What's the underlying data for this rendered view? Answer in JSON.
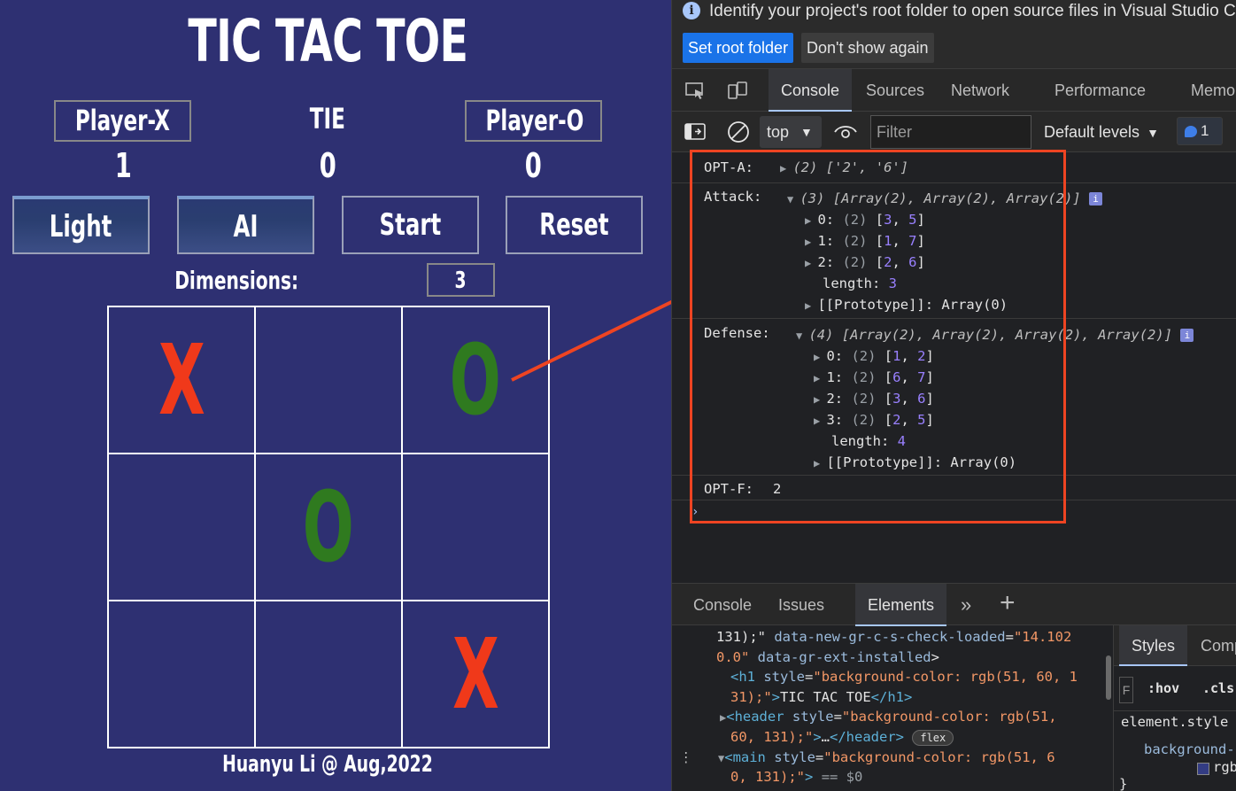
{
  "game": {
    "title": "TIC TAC TOE",
    "players": {
      "x_label": "Player-X",
      "tie_label": "TIE",
      "o_label": "Player-O"
    },
    "scores": {
      "x": "1",
      "tie": "0",
      "o": "0"
    },
    "buttons": {
      "light": "Light",
      "ai": "AI",
      "start": "Start",
      "reset": "Reset"
    },
    "dimensions_label": "Dimensions:",
    "dimensions_value": "3",
    "board": [
      "X",
      "",
      "O",
      "",
      "O",
      "",
      "",
      "",
      "X"
    ],
    "footer": "Huanyu Li @ Aug,2022",
    "colors": {
      "background": "#2e3072",
      "x_mark": "#f0391a",
      "o_mark": "#2f7a1f"
    }
  },
  "devtools": {
    "infobar": {
      "message": "Identify your project's root folder to open source files in Visual Studio Code",
      "set_root": "Set root folder",
      "dont_show": "Don't show again"
    },
    "tabs": [
      "Console",
      "Sources",
      "Network",
      "Performance",
      "Memo"
    ],
    "toolbar": {
      "context": "top",
      "filter_placeholder": "Filter",
      "levels": "Default levels",
      "message_count": "1"
    },
    "console": {
      "opt_a": {
        "label": "OPT-A:",
        "preview": "(2) ['2', '6']"
      },
      "attack": {
        "label": "Attack:",
        "preview": "(3) [Array(2), Array(2), Array(2)]",
        "items": [
          {
            "idx": "0",
            "values": [
              3,
              5
            ]
          },
          {
            "idx": "1",
            "values": [
              1,
              7
            ]
          },
          {
            "idx": "2",
            "values": [
              2,
              6
            ]
          }
        ],
        "length": "3"
      },
      "defense": {
        "label": "Defense:",
        "preview": "(4) [Array(2), Array(2), Array(2), Array(2)]",
        "items": [
          {
            "idx": "0",
            "values": [
              1,
              2
            ]
          },
          {
            "idx": "1",
            "values": [
              6,
              7
            ]
          },
          {
            "idx": "2",
            "values": [
              3,
              6
            ]
          },
          {
            "idx": "3",
            "values": [
              2,
              5
            ]
          }
        ],
        "length": "4"
      },
      "opt_f": {
        "label": "OPT-F:",
        "value": "2"
      },
      "prototype_text": "[[Prototype]]: Array(0)"
    },
    "drawer_tabs": [
      "Console",
      "Issues",
      "Elements"
    ],
    "styles_tabs": [
      "Styles",
      "Comp"
    ],
    "styles_filter": {
      "hov": ":hov",
      "cls": ".cls"
    },
    "element_style": "element.style",
    "style_prop": "background-",
    "style_value": "rgb",
    "flex_badge": "flex",
    "dom_eq": "== $0"
  }
}
